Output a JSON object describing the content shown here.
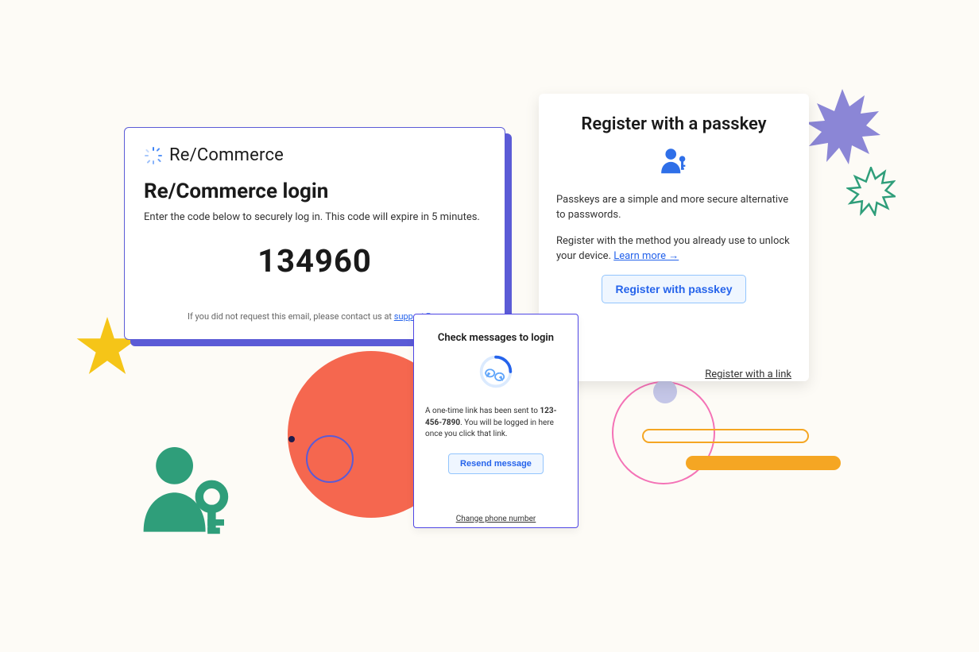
{
  "login": {
    "brand": "Re/Commerce",
    "title": "Re/Commerce login",
    "subtitle": "Enter the code below to securely log in. This code will expire in 5 minutes.",
    "code": "134960",
    "footer_prefix": "If you did not request this email, please contact us at ",
    "footer_email": "support@re."
  },
  "messages": {
    "title": "Check messages to login",
    "body_prefix": "A one-time link has been sent to ",
    "phone": "123-456-7890",
    "body_suffix": ". You will be logged in here once you click that link.",
    "resend_label": "Resend message",
    "change_label": "Change phone number"
  },
  "passkey": {
    "title": "Register with a passkey",
    "desc1": "Passkeys are a simple and more secure alternative to passwords.",
    "desc2_prefix": "Register with the method you already use to unlock your device. ",
    "learn_more": "Learn more",
    "button_label": "Register with passkey",
    "alt_link": "Register with a link"
  },
  "colors": {
    "accent_blue": "#2563eb",
    "card_border": "#5b5bd6",
    "coral": "#f5674f",
    "teal": "#2f9e7a",
    "amber": "#f5a623"
  }
}
